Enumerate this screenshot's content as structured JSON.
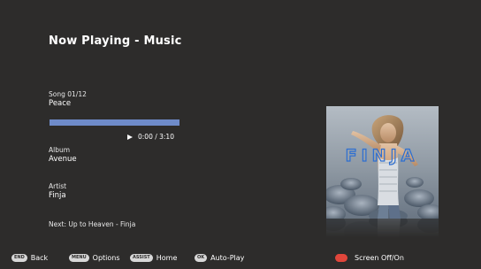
{
  "header": {
    "title": "Now Playing - Music"
  },
  "song": {
    "label": "Song 01/12",
    "name": "Peace"
  },
  "playback": {
    "progress_fraction": 0.0,
    "time_text": "0:00 / 3:10",
    "progress_color": "#6e8bc9"
  },
  "album": {
    "label": "Album",
    "name": "Avenue"
  },
  "artist": {
    "label": "Artist",
    "name": "Finja"
  },
  "next": {
    "text": "Next: Up to Heaven - Finja"
  },
  "cover": {
    "wordmark": "FINJA"
  },
  "footer": {
    "back_key": "END",
    "back_label": "Back",
    "options_key": "MENU",
    "options_label": "Options",
    "home_key": "ASSIST",
    "home_label": "Home",
    "autoplay_key": "OK",
    "autoplay_label": "Auto-Play",
    "screen_label": "Screen Off/On"
  },
  "colors": {
    "background": "#2d2c2b",
    "text": "#ffffff",
    "red_button": "#e0463b"
  }
}
